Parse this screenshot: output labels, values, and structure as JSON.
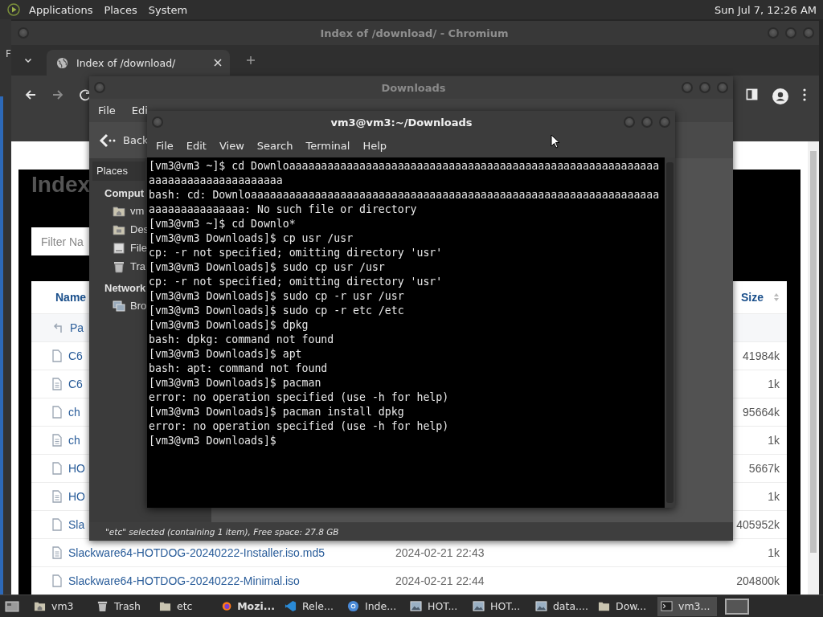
{
  "top_panel": {
    "menus": [
      "Applications",
      "Places",
      "System"
    ],
    "clock": "Sun Jul 7, 12:26 AM"
  },
  "background_window": {
    "label": "F"
  },
  "browser": {
    "title": "Index of /download/ - Chromium",
    "tabs": [
      {
        "label": "Index of /download/",
        "selected": true
      }
    ],
    "page": {
      "heading": "Index",
      "filter_placeholder": "Filter Na",
      "columns": [
        "Name",
        "Size"
      ],
      "rows": [
        {
          "kind": "parent",
          "name": "Pa"
        },
        {
          "kind": "file",
          "name": "C6",
          "size": "41984k"
        },
        {
          "kind": "text",
          "name": "C6",
          "size": "1k"
        },
        {
          "kind": "file",
          "name": "ch",
          "size": "95664k"
        },
        {
          "kind": "text",
          "name": "ch",
          "size": "1k"
        },
        {
          "kind": "file",
          "name": "HO",
          "size": "5667k"
        },
        {
          "kind": "text",
          "name": "HO",
          "size": "1k"
        },
        {
          "kind": "file",
          "name": "Sla",
          "size": "405952k"
        },
        {
          "kind": "text",
          "name": "Slackware64-HOTDOG-20240222-Installer.iso.md5",
          "date": "2024-02-21 22:43",
          "size": "1k"
        },
        {
          "kind": "file",
          "name": "Slackware64-HOTDOG-20240222-Minimal.iso",
          "date": "2024-02-21 22:44",
          "size": "204800k"
        }
      ]
    }
  },
  "file_manager": {
    "title": "Downloads",
    "menus": [
      "File",
      "Edi"
    ],
    "back": "Back",
    "places_label": "Places",
    "sections": [
      {
        "label": "Comput",
        "items": [
          {
            "kind": "home",
            "label": "vm"
          },
          {
            "kind": "desktop",
            "label": "Des"
          },
          {
            "kind": "filesystem",
            "label": "File"
          },
          {
            "kind": "trash",
            "label": "Tra"
          }
        ]
      },
      {
        "label": "Network",
        "items": [
          {
            "kind": "network",
            "label": "Bro"
          }
        ]
      }
    ],
    "status": "\"etc\" selected (containing 1 item), Free space: 27.8 GB"
  },
  "terminal": {
    "title": "vm3@vm3:~/Downloads",
    "menus": [
      "File",
      "Edit",
      "View",
      "Search",
      "Terminal",
      "Help"
    ],
    "lines": [
      "[vm3@vm3 ~]$ cd Downloaaaaaaaaaaaaaaaaaaaaaaaaaaaaaaaaaaaaaaaaaaaaaaaaaaaaaaaaaa",
      "aaaaaaaaaaaaaaaaaaaaa",
      "bash: cd: Downloaaaaaaaaaaaaaaaaaaaaaaaaaaaaaaaaaaaaaaaaaaaaaaaaaaaaaaaaaaaaaaaa",
      "aaaaaaaaaaaaaaa: No such file or directory",
      "[vm3@vm3 ~]$ cd Downlo*",
      "[vm3@vm3 Downloads]$ cp usr /usr",
      "cp: -r not specified; omitting directory 'usr'",
      "[vm3@vm3 Downloads]$ sudo cp usr /usr",
      "cp: -r not specified; omitting directory 'usr'",
      "[vm3@vm3 Downloads]$ sudo cp -r usr /usr",
      "[vm3@vm3 Downloads]$ sudo cp -r etc /etc",
      "[vm3@vm3 Downloads]$ dpkg",
      "bash: dpkg: command not found",
      "[vm3@vm3 Downloads]$ apt",
      "bash: apt: command not found",
      "[vm3@vm3 Downloads]$ pacman",
      "error: no operation specified (use -h for help)",
      "[vm3@vm3 Downloads]$ pacman install dpkg",
      "error: no operation specified (use -h for help)",
      "[vm3@vm3 Downloads]$"
    ]
  },
  "taskbar": {
    "items": [
      {
        "kind": "home",
        "label": "vm3",
        "selected": false,
        "attention": false
      },
      {
        "kind": "trash",
        "label": "Trash",
        "selected": false,
        "attention": false
      },
      {
        "kind": "folder",
        "label": "etc",
        "selected": false,
        "attention": false
      },
      {
        "kind": "firefox",
        "label": "Mozi...",
        "selected": false,
        "attention": true
      },
      {
        "kind": "vscode",
        "label": "Rele...",
        "selected": false,
        "attention": false
      },
      {
        "kind": "chrome",
        "label": "Inde...",
        "selected": false,
        "attention": false
      },
      {
        "kind": "image",
        "label": "HOT...",
        "selected": false,
        "attention": false
      },
      {
        "kind": "image",
        "label": "HOT...",
        "selected": false,
        "attention": false
      },
      {
        "kind": "image",
        "label": "data....",
        "selected": false,
        "attention": false
      },
      {
        "kind": "folder",
        "label": "Dow...",
        "selected": false,
        "attention": false
      },
      {
        "kind": "terminal",
        "label": "vm3...",
        "selected": true,
        "attention": false
      }
    ]
  }
}
